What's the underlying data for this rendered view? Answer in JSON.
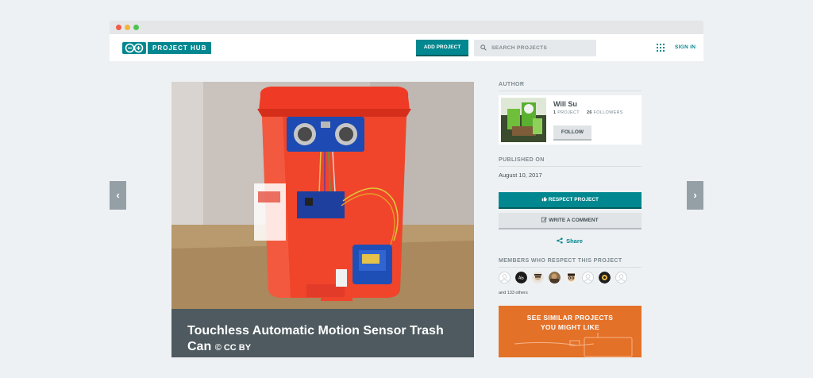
{
  "header": {
    "logo_text": "PROJECT HUB",
    "add_project_label": "ADD PROJECT",
    "search_placeholder": "SEARCH PROJECTS",
    "sign_in_label": "SIGN IN"
  },
  "carousel": {
    "prev_icon": "‹",
    "next_icon": "›"
  },
  "project": {
    "title": "Touchless Automatic Motion Sensor Trash Can",
    "license": "© CC BY"
  },
  "author": {
    "section_label": "AUTHOR",
    "name": "Will Su",
    "projects_count": "1",
    "projects_label": "PROJECT",
    "followers_count": "26",
    "followers_label": "FOLLOWERS",
    "follow_label": "FOLLOW"
  },
  "published": {
    "section_label": "PUBLISHED ON",
    "date": "August 10, 2017"
  },
  "actions": {
    "respect_label": "RESPECT PROJECT",
    "comment_label": "WRITE A COMMENT",
    "share_label": "Share"
  },
  "members": {
    "section_label": "MEMBERS WHO RESPECT THIS PROJECT",
    "others_text": "and 133 others"
  },
  "similar": {
    "line1": "SEE SIMILAR PROJECTS",
    "line2": "YOU MIGHT LIKE"
  },
  "colors": {
    "teal": "#00878f",
    "orange": "#e47128",
    "title_band": "#4e5a5f"
  }
}
